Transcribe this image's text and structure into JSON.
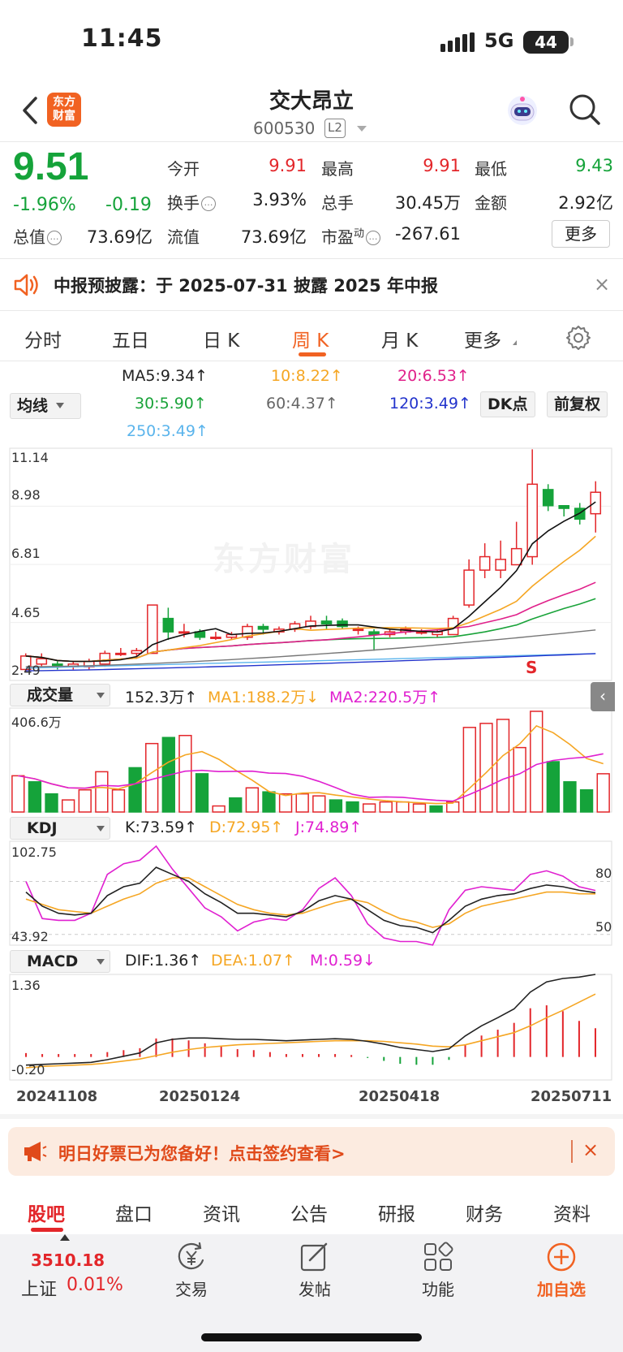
{
  "status_bar": {
    "time": "11:45",
    "network": "5G",
    "battery": "44"
  },
  "header": {
    "logo_text_line1": "东方",
    "logo_text_line2": "财富",
    "stock_name": "交大昂立",
    "stock_code": "600530",
    "level_badge": "L2"
  },
  "quote": {
    "price": "9.51",
    "change_pct": "-1.96%",
    "change": "-0.19",
    "open_label": "今开",
    "open": "9.91",
    "high_label": "最高",
    "high": "9.91",
    "low_label": "最低",
    "low": "9.43",
    "turnover_label": "换手",
    "turnover": "3.93%",
    "volume_label": "总手",
    "volume": "30.45万",
    "amount_label": "金额",
    "amount": "2.92亿",
    "total_value_label": "总值",
    "total_value": "73.69亿",
    "float_value_label": "流值",
    "float_value": "73.69亿",
    "pe_label": "市盈",
    "pe_sup": "动",
    "pe": "-267.61",
    "more_label": "更多"
  },
  "notice": {
    "text": "中报预披露：于 2025-07-31 披露 2025 年中报",
    "close": "×"
  },
  "chart_tabs": [
    {
      "label": "分时"
    },
    {
      "label": "五日"
    },
    {
      "label": "日 K"
    },
    {
      "label": "周 K",
      "active": true
    },
    {
      "label": "月 K"
    },
    {
      "label": "更多"
    }
  ],
  "ma_legend": {
    "selector": "均线",
    "ma5": "MA5:9.34↑",
    "ma10": "10:8.22↑",
    "ma20": "20:6.53↑",
    "ma30": "30:5.90↑",
    "ma60": "60:4.37↑",
    "ma120": "120:3.49↑",
    "ma250": "250:3.49↑",
    "dk_button": "DK点",
    "adjust_button": "前复权"
  },
  "colors": {
    "up": "#e3262a",
    "down": "#15a33a",
    "ma5": "#111111",
    "ma10": "#f5a623",
    "ma20": "#e0208a",
    "ma30": "#1aa33a",
    "ma60": "#777777",
    "ma120": "#2233cc",
    "ma250": "#5ab4ec",
    "accent": "#f16222"
  },
  "chart_data": {
    "type": "candlestick",
    "period": "weekly",
    "price_axis": {
      "top": "11.14",
      "mid1": "8.98",
      "mid2": "6.81",
      "mid3": "4.65",
      "bottom": "2.49",
      "ylim": [
        2.49,
        11.14
      ]
    },
    "watermark": "东方财富",
    "signal_label": "S",
    "candles": [
      {
        "o": 2.9,
        "c": 3.4,
        "h": 3.5,
        "l": 2.8
      },
      {
        "o": 3.1,
        "c": 3.3,
        "h": 3.5,
        "l": 3.0
      },
      {
        "o": 3.1,
        "c": 3.0,
        "h": 3.2,
        "l": 2.9
      },
      {
        "o": 3.0,
        "c": 3.1,
        "h": 3.2,
        "l": 2.9
      },
      {
        "o": 3.0,
        "c": 3.2,
        "h": 3.3,
        "l": 2.9
      },
      {
        "o": 3.1,
        "c": 3.5,
        "h": 3.6,
        "l": 3.0
      },
      {
        "o": 3.5,
        "c": 3.5,
        "h": 3.7,
        "l": 3.4
      },
      {
        "o": 3.5,
        "c": 3.6,
        "h": 3.7,
        "l": 3.4
      },
      {
        "o": 3.5,
        "c": 5.3,
        "h": 5.3,
        "l": 3.5
      },
      {
        "o": 4.8,
        "c": 4.3,
        "h": 5.2,
        "l": 4.0
      },
      {
        "o": 4.3,
        "c": 4.3,
        "h": 4.6,
        "l": 4.1
      },
      {
        "o": 4.3,
        "c": 4.1,
        "h": 4.4,
        "l": 4.0
      },
      {
        "o": 4.1,
        "c": 4.1,
        "h": 4.3,
        "l": 4.0
      },
      {
        "o": 4.1,
        "c": 4.2,
        "h": 4.3,
        "l": 4.0
      },
      {
        "o": 4.1,
        "c": 4.5,
        "h": 4.6,
        "l": 4.0
      },
      {
        "o": 4.5,
        "c": 4.4,
        "h": 4.6,
        "l": 4.2
      },
      {
        "o": 4.3,
        "c": 4.4,
        "h": 4.5,
        "l": 4.2
      },
      {
        "o": 4.4,
        "c": 4.6,
        "h": 4.7,
        "l": 4.3
      },
      {
        "o": 4.5,
        "c": 4.7,
        "h": 4.9,
        "l": 4.4
      },
      {
        "o": 4.7,
        "c": 4.6,
        "h": 4.9,
        "l": 4.4
      },
      {
        "o": 4.7,
        "c": 4.5,
        "h": 4.8,
        "l": 4.4
      },
      {
        "o": 4.4,
        "c": 4.4,
        "h": 4.5,
        "l": 4.2
      },
      {
        "o": 4.3,
        "c": 4.2,
        "h": 4.4,
        "l": 3.6
      },
      {
        "o": 4.2,
        "c": 4.3,
        "h": 4.4,
        "l": 4.1
      },
      {
        "o": 4.3,
        "c": 4.4,
        "h": 4.5,
        "l": 4.2
      },
      {
        "o": 4.3,
        "c": 4.3,
        "h": 4.4,
        "l": 4.2
      },
      {
        "o": 4.2,
        "c": 4.3,
        "h": 4.4,
        "l": 4.1
      },
      {
        "o": 4.2,
        "c": 4.8,
        "h": 4.9,
        "l": 4.2
      },
      {
        "o": 5.3,
        "c": 6.6,
        "h": 7.0,
        "l": 5.2
      },
      {
        "o": 6.6,
        "c": 7.1,
        "h": 7.6,
        "l": 6.3
      },
      {
        "o": 6.6,
        "c": 7.0,
        "h": 7.7,
        "l": 6.3
      },
      {
        "o": 6.8,
        "c": 7.4,
        "h": 8.4,
        "l": 6.8
      },
      {
        "o": 7.1,
        "c": 9.8,
        "h": 11.1,
        "l": 6.8
      },
      {
        "o": 9.6,
        "c": 9.0,
        "h": 9.8,
        "l": 8.8
      },
      {
        "o": 9.0,
        "c": 8.9,
        "h": 9.0,
        "l": 8.6
      },
      {
        "o": 8.9,
        "c": 8.5,
        "h": 9.1,
        "l": 8.3
      },
      {
        "o": 8.7,
        "c": 9.5,
        "h": 9.91,
        "l": 8.0
      }
    ],
    "volume": {
      "selector": "成交量",
      "current": "152.3万↑",
      "ma1": "MA1:188.2万↓",
      "ma2": "MA2:220.5万↑",
      "axis_top": "406.6万",
      "bars": [
        90,
        75,
        45,
        30,
        55,
        100,
        55,
        110,
        170,
        185,
        190,
        95,
        15,
        35,
        60,
        50,
        45,
        45,
        40,
        30,
        25,
        20,
        25,
        25,
        20,
        15,
        25,
        210,
        220,
        230,
        160,
        250,
        125,
        75,
        55,
        95
      ],
      "up": [
        1,
        0,
        0,
        1,
        1,
        1,
        1,
        0,
        1,
        0,
        1,
        0,
        1,
        0,
        1,
        0,
        1,
        1,
        1,
        0,
        0,
        1,
        1,
        1,
        1,
        0,
        1,
        1,
        1,
        1,
        1,
        1,
        0,
        0,
        0,
        1
      ]
    },
    "kdj": {
      "selector": "KDJ",
      "k": "K:73.59↑",
      "d": "D:72.95↑",
      "j": "J:74.89↑",
      "axis_top": "102.75",
      "axis_bottom": "43.92",
      "ref_high": "80",
      "ref_low": "50",
      "ylim": [
        43.92,
        102.75
      ],
      "K": [
        74,
        66,
        62,
        61,
        62,
        72,
        77,
        79,
        88,
        84,
        80,
        73,
        68,
        62,
        62,
        61,
        60,
        63,
        69,
        72,
        70,
        64,
        58,
        55,
        54,
        51,
        58,
        66,
        70,
        72,
        73,
        76,
        78,
        77,
        75,
        73.59
      ],
      "D": [
        70,
        67,
        64,
        63,
        62,
        66,
        70,
        73,
        79,
        82,
        82,
        77,
        72,
        67,
        64,
        62,
        61,
        62,
        65,
        68,
        70,
        68,
        63,
        59,
        57,
        54,
        56,
        62,
        66,
        68,
        70,
        72,
        74,
        74,
        73,
        72.95
      ],
      "J": [
        80,
        59,
        58,
        58,
        62,
        84,
        90,
        92,
        100,
        87,
        76,
        65,
        60,
        52,
        57,
        59,
        58,
        64,
        76,
        82,
        72,
        56,
        48,
        46,
        46,
        44,
        64,
        75,
        77,
        76,
        75,
        84,
        86,
        83,
        77,
        74.89
      ]
    },
    "macd": {
      "selector": "MACD",
      "dif": "DIF:1.36↑",
      "dea": "DEA:1.07↑",
      "m": "M:0.59↓",
      "axis_top": "1.36",
      "axis_bottom": "-0.20",
      "ylim": [
        -0.2,
        1.36
      ],
      "DIF": [
        0.02,
        0.03,
        0.04,
        0.05,
        0.06,
        0.1,
        0.15,
        0.2,
        0.35,
        0.4,
        0.42,
        0.42,
        0.41,
        0.4,
        0.4,
        0.39,
        0.38,
        0.39,
        0.4,
        0.41,
        0.4,
        0.37,
        0.33,
        0.28,
        0.25,
        0.22,
        0.26,
        0.45,
        0.6,
        0.72,
        0.85,
        1.1,
        1.25,
        1.3,
        1.32,
        1.36
      ],
      "DEA": [
        -0.02,
        0.0,
        0.01,
        0.02,
        0.03,
        0.05,
        0.08,
        0.11,
        0.16,
        0.21,
        0.25,
        0.28,
        0.3,
        0.32,
        0.33,
        0.34,
        0.35,
        0.36,
        0.37,
        0.38,
        0.38,
        0.38,
        0.37,
        0.35,
        0.33,
        0.3,
        0.29,
        0.32,
        0.38,
        0.44,
        0.5,
        0.6,
        0.72,
        0.83,
        0.95,
        1.07
      ],
      "M": [
        0.08,
        0.06,
        0.06,
        0.06,
        0.06,
        0.1,
        0.14,
        0.18,
        0.38,
        0.38,
        0.34,
        0.28,
        0.22,
        0.16,
        0.14,
        0.1,
        0.06,
        0.06,
        0.06,
        0.06,
        0.04,
        -0.02,
        -0.08,
        -0.14,
        -0.16,
        -0.16,
        -0.06,
        0.26,
        0.44,
        0.56,
        0.7,
        1.0,
        1.06,
        0.94,
        0.74,
        0.59
      ]
    },
    "dates": [
      "20241108",
      "20250124",
      "20250418",
      "20250711"
    ]
  },
  "promo": {
    "text": "明日好票已为您备好！点击签约查看>",
    "close": "×"
  },
  "bottom_tabs": [
    {
      "label": "股吧",
      "active": true
    },
    {
      "label": "盘口"
    },
    {
      "label": "资讯"
    },
    {
      "label": "公告"
    },
    {
      "label": "研报"
    },
    {
      "label": "财务"
    },
    {
      "label": "资料"
    }
  ],
  "toolbar": {
    "index_value": "3510.18",
    "index_name": "上证",
    "index_change": "0.01%",
    "trade": "交易",
    "post": "发帖",
    "function": "功能",
    "add_watch": "加自选"
  }
}
